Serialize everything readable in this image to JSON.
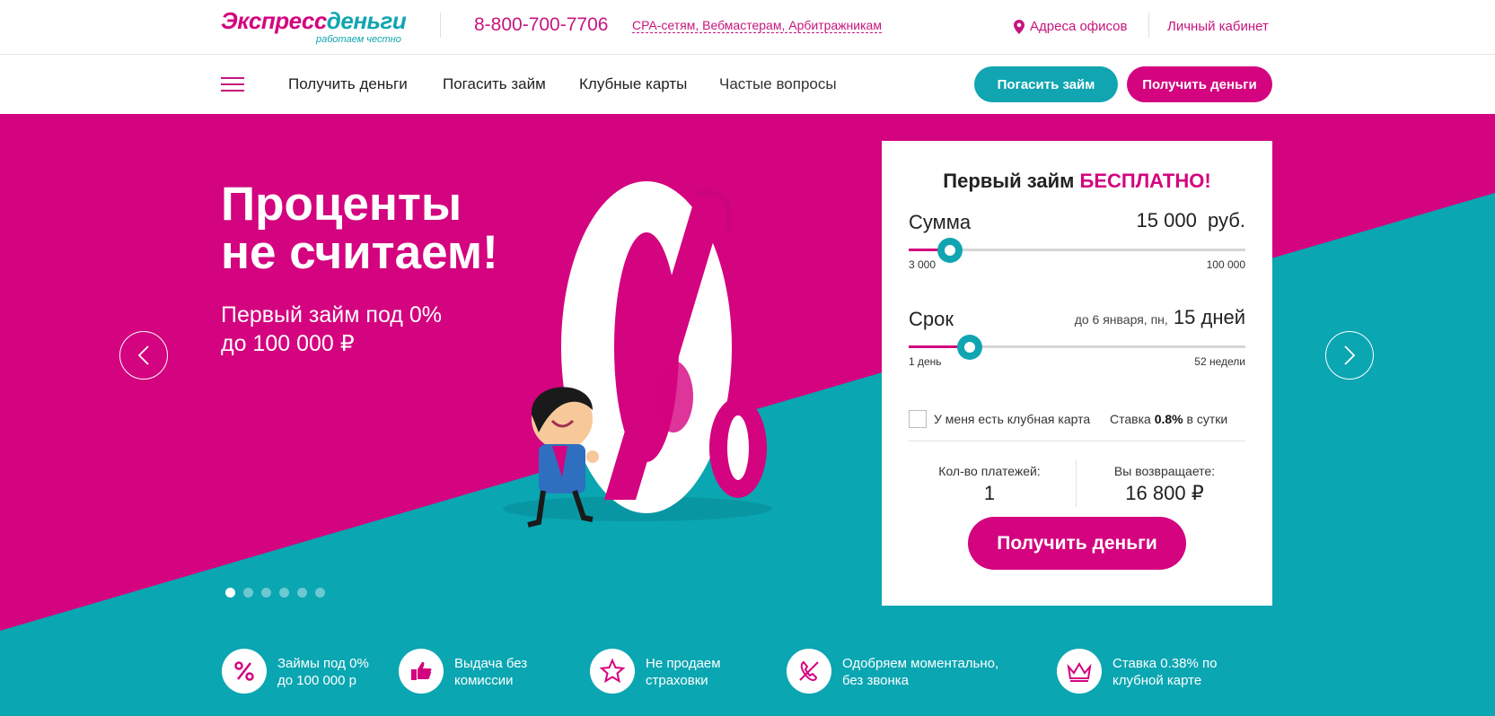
{
  "header": {
    "logo": {
      "part1": "Экспресс",
      "part2": "деньги",
      "tagline": "работаем честно"
    },
    "phone": "8-800-700-7706",
    "partners_link": "CPA-сетям, Вебмастерам, Арбитражникам",
    "offices_link": "Адреса офисов",
    "cabinet_link": "Личный кабинет"
  },
  "nav": {
    "items": [
      "Получить деньги",
      "Погасить займ",
      "Клубные карты",
      "Частые вопросы"
    ],
    "repay_button": "Погасить займ",
    "get_money_button": "Получить деньги"
  },
  "hero": {
    "headline_line1": "Проценты",
    "headline_line2": "не считаем!",
    "sub_line1": "Первый займ под 0%",
    "sub_line2": "до 100 000 ₽",
    "slides_total": 6,
    "active_slide": 1
  },
  "calculator": {
    "title_main": "Первый займ ",
    "title_highlight": "БЕСПЛАТНО!",
    "amount": {
      "label": "Сумма",
      "value": "15 000",
      "unit": "руб.",
      "min_label": "3 000",
      "max_label": "100 000",
      "min": 3000,
      "max": 100000,
      "current": 15000
    },
    "term": {
      "label": "Срок",
      "due_text": "до 6 января, пн,",
      "value": "15 дней",
      "min_label": "1 день",
      "max_label": "52 недели",
      "position_fraction": 0.18
    },
    "club_card_label": "У меня есть клубная карта",
    "rate_prefix": "Ставка ",
    "rate_value": "0.8%",
    "rate_suffix": " в сутки",
    "payments_caption": "Кол-во платежей:",
    "payments_value": "1",
    "return_caption": "Вы возвращаете:",
    "return_value": "16 800 ₽",
    "submit_button": "Получить деньги"
  },
  "features": [
    {
      "icon": "percent-icon",
      "text": "Займы под 0%\nдо 100 000 р"
    },
    {
      "icon": "thumbs-up-icon",
      "text": "Выдача без\nкомиссии"
    },
    {
      "icon": "star-icon",
      "text": "Не продаем\nстраховки"
    },
    {
      "icon": "phone-crossed-icon",
      "text": "Одобряем моментально,\nбез звонка"
    },
    {
      "icon": "crown-icon",
      "text": "Ставка 0.38% по\nклубной карте"
    }
  ],
  "colors": {
    "brand_magenta": "#d4037f",
    "brand_teal": "#10a5b1"
  }
}
